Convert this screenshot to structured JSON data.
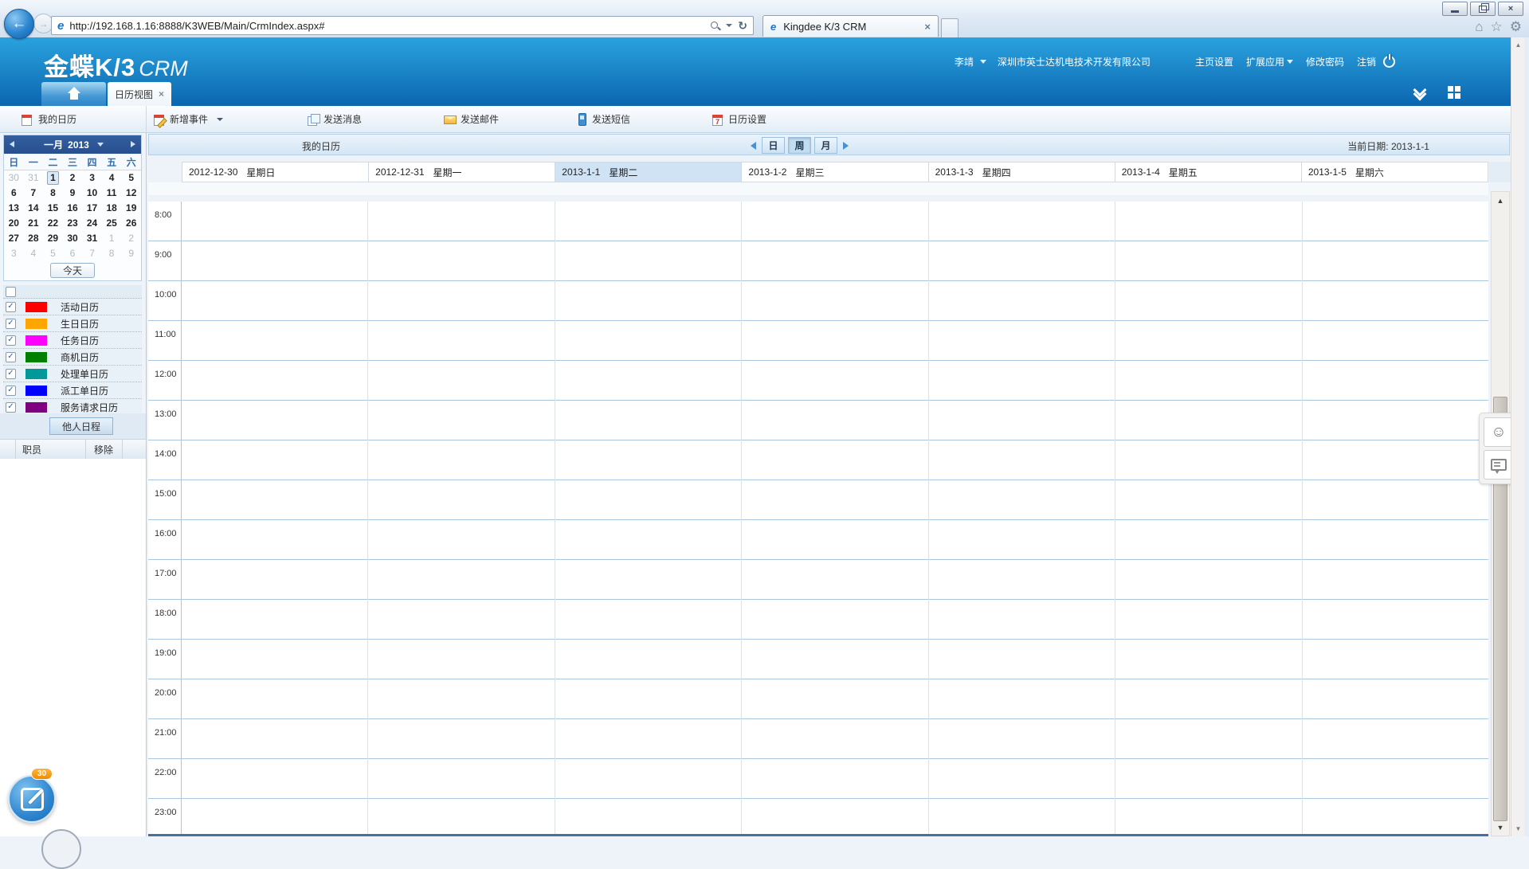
{
  "browser": {
    "url": "http://192.168.1.16:8888/K3WEB/Main/CrmIndex.aspx#",
    "tab_title": "Kingdee K/3 CRM",
    "favicon_letter": "e"
  },
  "glyphs": {
    "back": "←",
    "forward": "→",
    "refresh": "↻",
    "close": "×",
    "home": "⌂",
    "star": "☆",
    "gear": "⚙",
    "check": "✓",
    "smiley": "☺",
    "up": "▲",
    "down": "▼",
    "seven": "7"
  },
  "header": {
    "logo_main": "金蝶K/3",
    "logo_sub": "CRM",
    "user": "李靖",
    "company": "深圳市英士达机电技术开发有限公司",
    "links": [
      {
        "label": "主页设置",
        "caret": false
      },
      {
        "label": "扩展应用",
        "caret": true
      },
      {
        "label": "修改密码",
        "caret": false
      },
      {
        "label": "注销",
        "caret": false
      }
    ],
    "active_tab": "日历视图"
  },
  "toolbar": {
    "panel_title": "我的日历",
    "items": [
      {
        "label": "新增事件",
        "icon": "new-event-icon",
        "caret": true
      },
      {
        "label": "发送消息",
        "icon": "send-message-icon",
        "caret": false
      },
      {
        "label": "发送邮件",
        "icon": "send-mail-icon",
        "caret": false
      },
      {
        "label": "发送短信",
        "icon": "send-sms-icon",
        "caret": false
      },
      {
        "label": "日历设置",
        "icon": "calendar-settings-icon",
        "caret": false
      }
    ]
  },
  "minical": {
    "month": "一月",
    "year": "2013",
    "weekdays": [
      "日",
      "一",
      "二",
      "三",
      "四",
      "五",
      "六"
    ],
    "weeks": [
      [
        {
          "d": "30",
          "m": true
        },
        {
          "d": "31",
          "m": true
        },
        {
          "d": "1",
          "sel": true
        },
        {
          "d": "2"
        },
        {
          "d": "3"
        },
        {
          "d": "4"
        },
        {
          "d": "5"
        }
      ],
      [
        {
          "d": "6"
        },
        {
          "d": "7"
        },
        {
          "d": "8"
        },
        {
          "d": "9"
        },
        {
          "d": "10"
        },
        {
          "d": "11"
        },
        {
          "d": "12"
        }
      ],
      [
        {
          "d": "13"
        },
        {
          "d": "14"
        },
        {
          "d": "15"
        },
        {
          "d": "16"
        },
        {
          "d": "17"
        },
        {
          "d": "18"
        },
        {
          "d": "19"
        }
      ],
      [
        {
          "d": "20"
        },
        {
          "d": "21"
        },
        {
          "d": "22"
        },
        {
          "d": "23"
        },
        {
          "d": "24"
        },
        {
          "d": "25"
        },
        {
          "d": "26"
        }
      ],
      [
        {
          "d": "27"
        },
        {
          "d": "28"
        },
        {
          "d": "29"
        },
        {
          "d": "30"
        },
        {
          "d": "31"
        },
        {
          "d": "1",
          "m": true
        },
        {
          "d": "2",
          "m": true
        }
      ],
      [
        {
          "d": "3",
          "m": true
        },
        {
          "d": "4",
          "m": true
        },
        {
          "d": "5",
          "m": true
        },
        {
          "d": "6",
          "m": true
        },
        {
          "d": "7",
          "m": true
        },
        {
          "d": "8",
          "m": true
        },
        {
          "d": "9",
          "m": true
        }
      ]
    ],
    "today_label": "今天"
  },
  "calendar_list": [
    {
      "label": "活动日历",
      "color": "#ff0000"
    },
    {
      "label": "生日日历",
      "color": "#ffa500"
    },
    {
      "label": "任务日历",
      "color": "#ff00ff"
    },
    {
      "label": "商机日历",
      "color": "#008000"
    },
    {
      "label": "处理单日历",
      "color": "#009999"
    },
    {
      "label": "派工单日历",
      "color": "#0000ff"
    },
    {
      "label": "服务请求日历",
      "color": "#800080"
    }
  ],
  "others_label": "他人日程",
  "staff_columns": [
    "职员",
    "移除"
  ],
  "badge_count": "30",
  "main": {
    "title": "我的日历",
    "views": [
      "日",
      "周",
      "月"
    ],
    "active_view": "周",
    "current_date": "当前日期: 2013-1-1",
    "days": [
      {
        "date": "2012-12-30",
        "weekday": "星期日",
        "today": false
      },
      {
        "date": "2012-12-31",
        "weekday": "星期一",
        "today": false
      },
      {
        "date": "2013-1-1",
        "weekday": "星期二",
        "today": true
      },
      {
        "date": "2013-1-2",
        "weekday": "星期三",
        "today": false
      },
      {
        "date": "2013-1-3",
        "weekday": "星期四",
        "today": false
      },
      {
        "date": "2013-1-4",
        "weekday": "星期五",
        "today": false
      },
      {
        "date": "2013-1-5",
        "weekday": "星期六",
        "today": false
      }
    ],
    "hours": [
      "8:00",
      "9:00",
      "10:00",
      "11:00",
      "12:00",
      "13:00",
      "14:00",
      "15:00",
      "16:00",
      "17:00",
      "18:00",
      "19:00",
      "20:00",
      "21:00",
      "22:00",
      "23:00"
    ]
  }
}
